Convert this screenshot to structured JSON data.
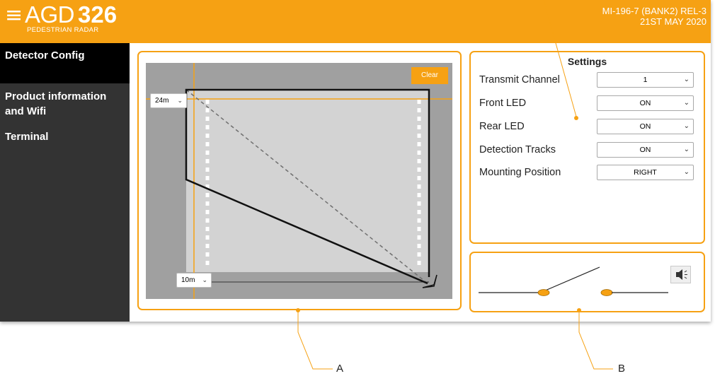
{
  "header": {
    "menu_glyph": "≡",
    "brand_prefix": "AGD",
    "brand_number": "326",
    "brand_subtitle": "PEDESTRIAN RADAR",
    "version": "MI-196-7 (BANK2) REL-3",
    "date": "21ST MAY 2020"
  },
  "sidebar": {
    "items": [
      {
        "label": "Detector Config",
        "active": true
      },
      {
        "label_line1": "Product information",
        "label_line2": "and Wifi",
        "active": false
      },
      {
        "label": "Terminal",
        "active": false
      }
    ]
  },
  "detection_zone": {
    "clear_label": "Clear",
    "range_select": "24m",
    "width_select": "10m"
  },
  "settings": {
    "title": "Settings",
    "rows": [
      {
        "label": "Transmit Channel",
        "value": "1"
      },
      {
        "label": "Front LED",
        "value": "ON"
      },
      {
        "label": "Rear LED",
        "value": "ON"
      },
      {
        "label": "Detection Tracks",
        "value": "ON"
      },
      {
        "label": "Mounting Position",
        "value": "RIGHT"
      }
    ]
  },
  "relay": {
    "icon": "speaker-muted-icon"
  },
  "callouts": {
    "a": "A",
    "b": "B"
  },
  "colors": {
    "accent": "#f6a113",
    "sidebar": "#333333",
    "sidebar_active": "#000000",
    "zone_background": "#a0a0a0",
    "zone_area": "#d3d3d3"
  }
}
